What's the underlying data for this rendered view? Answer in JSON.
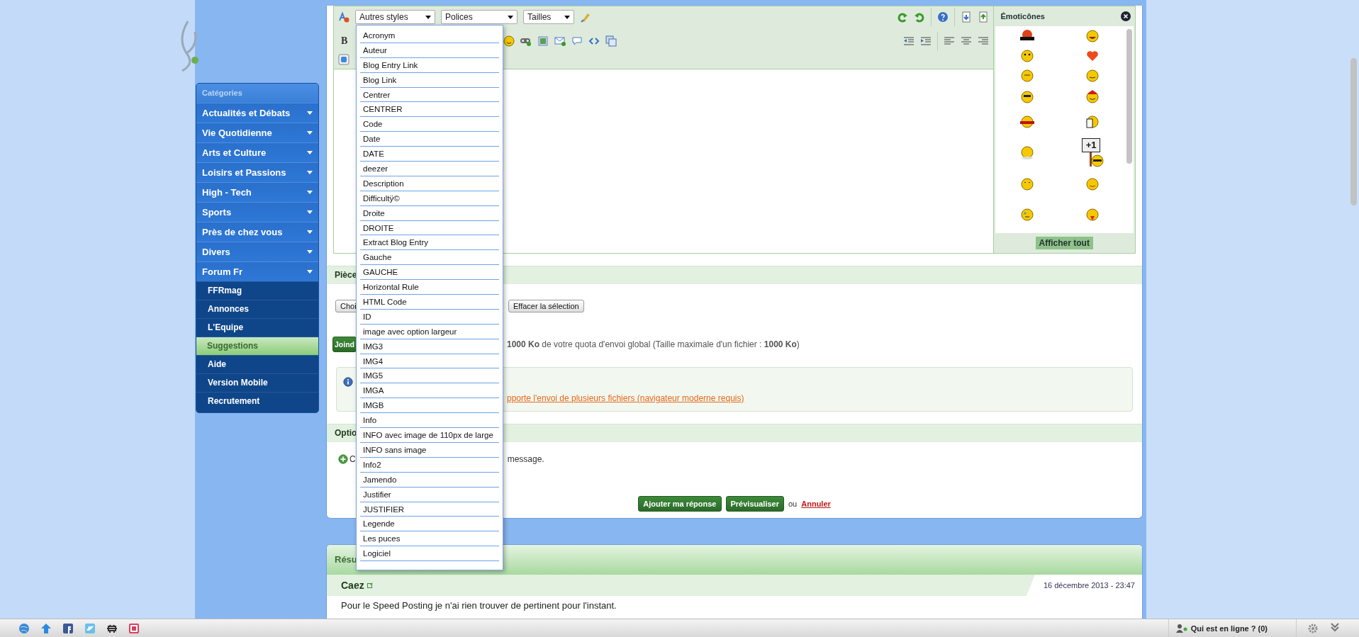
{
  "sidebar": {
    "title": "Catégories",
    "items": [
      {
        "label": "Actualités et Débats"
      },
      {
        "label": "Vie Quotidienne"
      },
      {
        "label": "Arts et Culture"
      },
      {
        "label": "Loisirs et Passions"
      },
      {
        "label": "High - Tech"
      },
      {
        "label": "Sports"
      },
      {
        "label": "Près de chez vous"
      },
      {
        "label": "Divers"
      },
      {
        "label": "Forum Fr"
      }
    ],
    "subitems": [
      {
        "label": "FFRmag",
        "selected": false
      },
      {
        "label": "Annonces",
        "selected": false
      },
      {
        "label": "L'Equipe",
        "selected": false
      },
      {
        "label": "Suggestions",
        "selected": true
      },
      {
        "label": "Aide",
        "selected": false
      },
      {
        "label": "Version Mobile",
        "selected": false
      },
      {
        "label": "Recrutement",
        "selected": false
      }
    ]
  },
  "editor": {
    "style_select": "Autres styles",
    "font_select": "Polices",
    "size_select": "Tailles",
    "bold": "B",
    "style_menu": [
      "Acronym",
      "Auteur",
      "Blog Entry Link",
      "Blog Link",
      "Centrer",
      "CENTRER",
      "Code",
      "Date",
      "DATE",
      "deezer",
      "Description",
      "Difficultÿ©",
      "Droite",
      "DROITE",
      "Extract Blog Entry",
      "Gauche",
      "GAUCHE",
      "Horizontal Rule",
      "HTML Code",
      "ID",
      "image avec option largeur",
      "IMG3",
      "IMG4",
      "IMG5",
      "IMGA",
      "IMGB",
      "Info",
      "INFO avec image de 110px de large",
      "INFO sans image",
      "Info2",
      "Jamendo",
      "Justifier",
      "JUSTIFIER",
      "Legende",
      "Les puces",
      "Logiciel"
    ],
    "emoticons": {
      "title": "Émoticônes",
      "sign_text": "+1",
      "show_all": "Afficher tout"
    }
  },
  "attachments": {
    "header": "Pièce",
    "choose_button": "Choi",
    "clear_button": "Effacer la sélection",
    "attach_button": "Joind",
    "quota": "**1000 Ko** de votre quota d'envoi global (Taille maximale d'un fichier : **1000 Ko**)",
    "info_link": "pporte l'envoi de plusieurs fichiers (navigateur moderne requis)"
  },
  "options": {
    "header": "Optio",
    "line_start": "C",
    "line_end": "message."
  },
  "actions": {
    "submit": "Ajouter ma réponse",
    "preview": "Prévisualiser",
    "or": "ou",
    "cancel": "Annuler"
  },
  "review": {
    "header": "Résu",
    "author": "Caez",
    "date": "16 décembre 2013 - 23:47",
    "text": "Pour le Speed Posting je n'ai rien trouver de pertinent pour l'instant."
  },
  "taskbar": {
    "online": "Qui est en ligne ? (0)"
  }
}
